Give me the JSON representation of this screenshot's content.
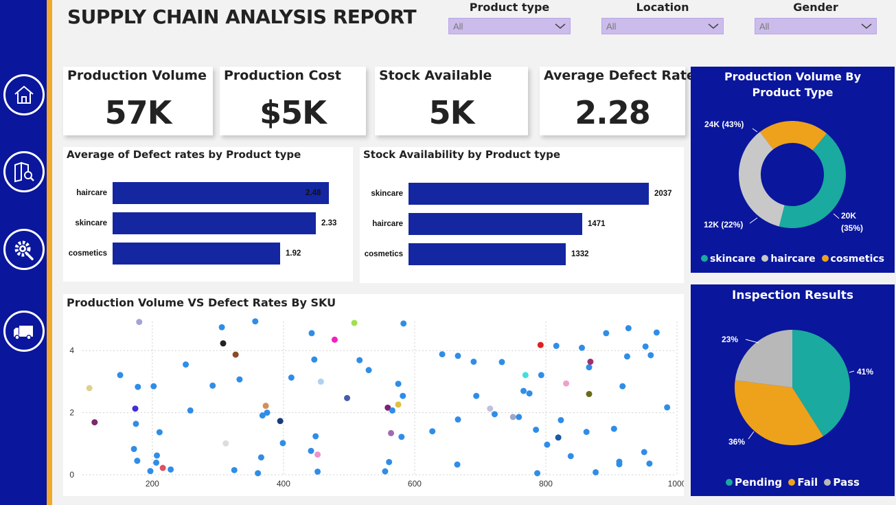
{
  "title": "SUPPLY CHAIN ANALYSIS REPORT",
  "sidebar": {
    "items": [
      {
        "icon": "home-icon"
      },
      {
        "icon": "search-book-icon"
      },
      {
        "icon": "gear-wrench-icon"
      },
      {
        "icon": "truck-icon"
      }
    ]
  },
  "filters": [
    {
      "label": "Product type",
      "value": "All"
    },
    {
      "label": "Location",
      "value": "All"
    },
    {
      "label": "Gender",
      "value": "All"
    }
  ],
  "kpis": [
    {
      "label": "Production Volume",
      "value": "57K"
    },
    {
      "label": "Production Cost",
      "value": "$5K"
    },
    {
      "label": "Stock Available",
      "value": "5K"
    },
    {
      "label": "Average Defect Rate",
      "value": "2.28"
    }
  ],
  "colors": {
    "navy": "#0a169c",
    "bar": "#1426a0",
    "teal": "#1aaa9f",
    "gray": "#c8c8c8",
    "orange": "#eea21c",
    "scatter": "#2f8de8",
    "accent": "#f0a92e"
  },
  "chart_data": [
    {
      "type": "bar",
      "orientation": "horizontal",
      "title": "Average of Defect rates by Product type",
      "categories": [
        "haircare",
        "skincare",
        "cosmetics"
      ],
      "values": [
        2.48,
        2.33,
        1.92
      ],
      "labels": [
        "2.48",
        "2.33",
        "1.92"
      ]
    },
    {
      "type": "bar",
      "orientation": "horizontal",
      "title": "Stock Availability by Product type",
      "categories": [
        "skincare",
        "haircare",
        "cosmetics"
      ],
      "values": [
        2037,
        1471,
        1332
      ],
      "labels": [
        "2037",
        "1471",
        "1332"
      ]
    },
    {
      "type": "pie",
      "donut": true,
      "title": "Production Volume By Product Type",
      "categories": [
        "skincare",
        "haircare",
        "cosmetics"
      ],
      "values": [
        24,
        20,
        12
      ],
      "percents": [
        43,
        35,
        22
      ],
      "labels": [
        "24K (43%)",
        "20K (35%)",
        "12K (22%)"
      ],
      "legend": "bottom"
    },
    {
      "type": "pie",
      "title": "Inspection Results",
      "categories": [
        "Pending",
        "Fail",
        "Pass"
      ],
      "values": [
        41,
        36,
        23
      ],
      "labels": [
        "41%",
        "36%",
        "23%"
      ],
      "legend": "bottom"
    },
    {
      "type": "scatter",
      "title": "Production Volume VS Defect Rates By SKU",
      "xlim": [
        85,
        1000
      ],
      "ylim": [
        0,
        5
      ],
      "xticks": [
        200,
        400,
        600,
        800,
        1000
      ],
      "yticks": [
        0,
        2,
        4
      ],
      "grid": true,
      "points": [
        [
          104,
          2.79,
          "#e0d08a"
        ],
        [
          112,
          1.69,
          "#7b2a6b"
        ],
        [
          151,
          3.21,
          "#2f8de8"
        ],
        [
          172,
          0.83,
          "#2f8de8"
        ],
        [
          174,
          2.13,
          "#3f2fd8"
        ],
        [
          175,
          1.64,
          "#2f8de8"
        ],
        [
          177,
          0.45,
          "#2f8de8"
        ],
        [
          178,
          2.83,
          "#2f8de8"
        ],
        [
          180,
          4.92,
          "#a5a3d6"
        ],
        [
          197,
          0.12,
          "#2f8de8"
        ],
        [
          202,
          2.85,
          "#2f8de8"
        ],
        [
          206,
          0.39,
          "#2f8de8"
        ],
        [
          207,
          0.62,
          "#2f8de8"
        ],
        [
          211,
          1.37,
          "#2f8de8"
        ],
        [
          216,
          0.22,
          "#e05060"
        ],
        [
          228,
          0.17,
          "#2f8de8"
        ],
        [
          251,
          3.55,
          "#2f8de8"
        ],
        [
          258,
          2.07,
          "#2f8de8"
        ],
        [
          292,
          2.87,
          "#2f8de8"
        ],
        [
          306,
          4.75,
          "#2f8de8"
        ],
        [
          308,
          4.23,
          "#222222"
        ],
        [
          312,
          1.01,
          "#dcdcdc"
        ],
        [
          325,
          0.15,
          "#2f8de8"
        ],
        [
          327,
          3.87,
          "#8a4a2a"
        ],
        [
          333,
          3.07,
          "#2f8de8"
        ],
        [
          357,
          4.94,
          "#2f8de8"
        ],
        [
          361,
          0.05,
          "#2f8de8"
        ],
        [
          366,
          0.56,
          "#2f8de8"
        ],
        [
          368,
          1.91,
          "#2f8de8"
        ],
        [
          373,
          2.22,
          "#d0905a"
        ],
        [
          375,
          2.0,
          "#2f8de8"
        ],
        [
          395,
          1.73,
          "#1a3a7a"
        ],
        [
          399,
          1.02,
          "#2f8de8"
        ],
        [
          412,
          3.13,
          "#2f8de8"
        ],
        [
          442,
          0.77,
          "#2f8de8"
        ],
        [
          443,
          4.56,
          "#2f8de8"
        ],
        [
          447,
          3.71,
          "#2f8de8"
        ],
        [
          449,
          1.24,
          "#2f8de8"
        ],
        [
          452,
          0.1,
          "#2f8de8"
        ],
        [
          452,
          0.65,
          "#f090d0"
        ],
        [
          457,
          3.0,
          "#b0d0f0"
        ],
        [
          478,
          4.35,
          "#f020c0"
        ],
        [
          497,
          2.47,
          "#4a5aa8"
        ],
        [
          508,
          4.89,
          "#a0e050"
        ],
        [
          516,
          3.69,
          "#2f8de8"
        ],
        [
          530,
          3.37,
          "#2f8de8"
        ],
        [
          555,
          0.11,
          "#2f8de8"
        ],
        [
          559,
          2.16,
          "#802070"
        ],
        [
          561,
          0.41,
          "#2f8de8"
        ],
        [
          564,
          1.34,
          "#a06ab0"
        ],
        [
          566,
          2.07,
          "#2f8de8"
        ],
        [
          575,
          2.26,
          "#e0c040"
        ],
        [
          575,
          2.93,
          "#2f8de8"
        ],
        [
          580,
          1.22,
          "#2f8de8"
        ],
        [
          582,
          2.54,
          "#2f8de8"
        ],
        [
          583,
          4.87,
          "#2f8de8"
        ],
        [
          627,
          1.4,
          "#2f8de8"
        ],
        [
          642,
          3.88,
          "#2f8de8"
        ],
        [
          665,
          0.33,
          "#2f8de8"
        ],
        [
          666,
          3.83,
          "#2f8de8"
        ],
        [
          666,
          1.78,
          "#2f8de8"
        ],
        [
          690,
          3.64,
          "#2f8de8"
        ],
        [
          694,
          2.54,
          "#2f8de8"
        ],
        [
          715,
          2.13,
          "#c0c0e0"
        ],
        [
          722,
          1.95,
          "#2f8de8"
        ],
        [
          733,
          3.63,
          "#2f8de8"
        ],
        [
          750,
          1.86,
          "#a0a8c8"
        ],
        [
          759,
          1.86,
          "#2f8de8"
        ],
        [
          766,
          2.7,
          "#2f8de8"
        ],
        [
          769,
          3.21,
          "#40e0e0"
        ],
        [
          775,
          2.62,
          "#2f8de8"
        ],
        [
          785,
          1.45,
          "#2f8de8"
        ],
        [
          787,
          0.05,
          "#2f8de8"
        ],
        [
          792,
          4.18,
          "#e02020"
        ],
        [
          793,
          3.21,
          "#2f8de8"
        ],
        [
          802,
          0.97,
          "#2f8de8"
        ],
        [
          816,
          4.15,
          "#2f8de8"
        ],
        [
          819,
          1.2,
          "#1a5aa8"
        ],
        [
          823,
          1.76,
          "#2f8de8"
        ],
        [
          831,
          2.94,
          "#f0a0d0"
        ],
        [
          838,
          0.6,
          "#2f8de8"
        ],
        [
          862,
          1.38,
          "#2f8de8"
        ],
        [
          866,
          2.6,
          "#6a6a1a"
        ],
        [
          866,
          3.46,
          "#2f8de8"
        ],
        [
          868,
          3.64,
          "#a03070"
        ],
        [
          876,
          0.08,
          "#2f8de8"
        ],
        [
          892,
          4.56,
          "#2f8de8"
        ],
        [
          904,
          1.48,
          "#2f8de8"
        ],
        [
          912,
          0.42,
          "#2f8de8"
        ],
        [
          912,
          0.34,
          "#2f8de8"
        ],
        [
          917,
          2.85,
          "#2f8de8"
        ],
        [
          924,
          3.81,
          "#2f8de8"
        ],
        [
          926,
          4.72,
          "#2f8de8"
        ],
        [
          950,
          0.73,
          "#2f8de8"
        ],
        [
          952,
          4.13,
          "#2f8de8"
        ],
        [
          958,
          0.36,
          "#2f8de8"
        ],
        [
          960,
          3.85,
          "#2f8de8"
        ],
        [
          969,
          4.58,
          "#2f8de8"
        ],
        [
          985,
          2.17,
          "#2f8de8"
        ],
        [
          855,
          4.09,
          "#2f8de8"
        ]
      ]
    }
  ]
}
